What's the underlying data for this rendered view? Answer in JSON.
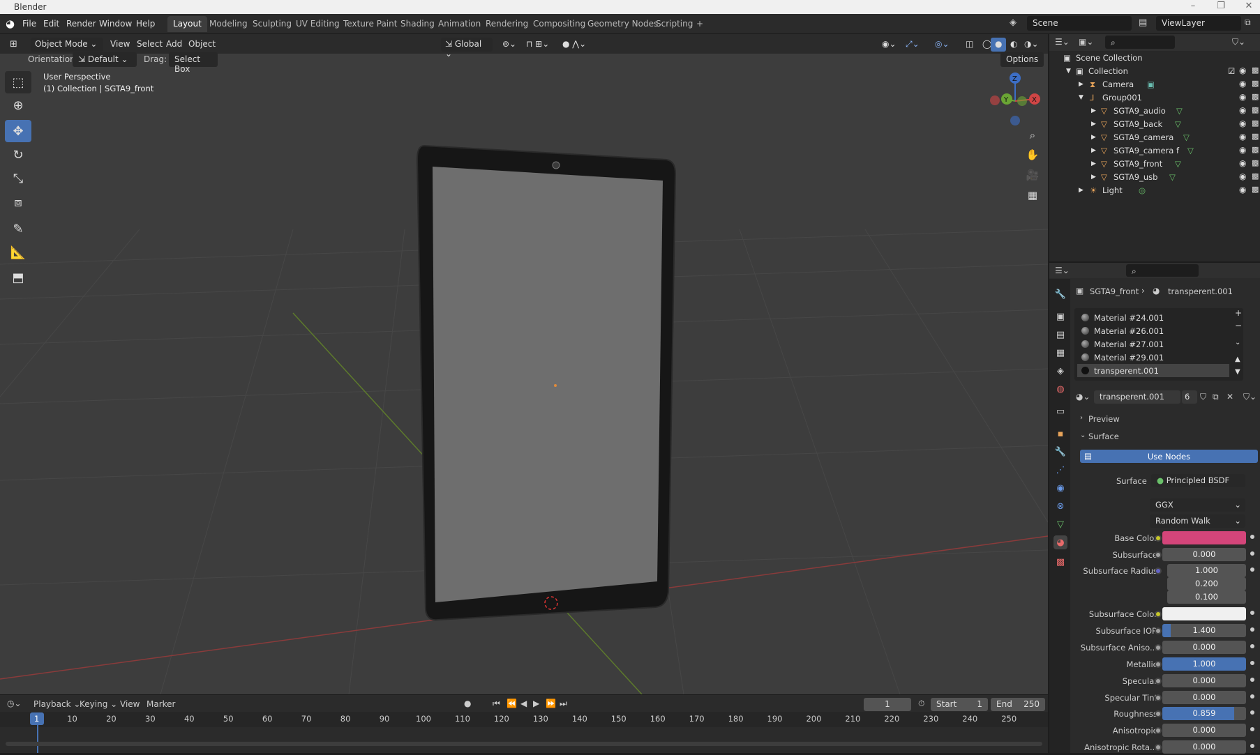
{
  "title_bar": {
    "title": "Blender",
    "minimize": "–",
    "restore": "❐",
    "close": "✕"
  },
  "menu": [
    "File",
    "Edit",
    "Render",
    "Window",
    "Help"
  ],
  "workspaces": [
    "Layout",
    "Modeling",
    "Sculpting",
    "UV Editing",
    "Texture Paint",
    "Shading",
    "Animation",
    "Rendering",
    "Compositing",
    "Geometry Nodes",
    "Scripting",
    "+"
  ],
  "scene": {
    "name": "Scene",
    "view_layer": "ViewLayer"
  },
  "viewport_header": {
    "mode": "Object Mode",
    "view": "View",
    "select": "Select",
    "add": "Add",
    "object": "Object",
    "transform": "Global",
    "orientation_label": "Orientation:",
    "orientation": "Default",
    "drag_label": "Drag:",
    "drag": "Select Box",
    "options": "Options"
  },
  "viewport_info": {
    "line1": "User Perspective",
    "line2": "(1) Collection | SGTA9_front"
  },
  "gizmo": {
    "x": "X",
    "y": "Y",
    "z": "Z"
  },
  "outliner": {
    "scene_collection": "Scene Collection",
    "collection": "Collection",
    "items": [
      {
        "label": "Camera"
      },
      {
        "label": "Group001"
      },
      {
        "label": "SGTA9_audio"
      },
      {
        "label": "SGTA9_back"
      },
      {
        "label": "SGTA9_camera"
      },
      {
        "label": "SGTA9_camera f"
      },
      {
        "label": "SGTA9_front"
      },
      {
        "label": "SGTA9_usb"
      },
      {
        "label": "Light"
      }
    ]
  },
  "properties": {
    "breadcrumb_object": "SGTA9_front",
    "breadcrumb_material": "transperent.001",
    "materials": [
      "Material #24.001",
      "Material #26.001",
      "Material #27.001",
      "Material #29.001",
      "transperent.001"
    ],
    "material_name": "transperent.001",
    "users": "6",
    "preview": "Preview",
    "surface_panel": "Surface",
    "use_nodes": "Use Nodes",
    "surface_label": "Surface",
    "surface_shader": "Principled BSDF",
    "distribution": "GGX",
    "subsurface_method": "Random Walk",
    "rows": [
      {
        "label": "Base Color",
        "value": ""
      },
      {
        "label": "Subsurface",
        "value": "0.000"
      },
      {
        "label": "Subsurface Radius",
        "value": "1.000"
      },
      {
        "label": "",
        "value": "0.200"
      },
      {
        "label": "",
        "value": "0.100"
      },
      {
        "label": "Subsurface Color",
        "value": ""
      },
      {
        "label": "Subsurface IOR",
        "value": "1.400"
      },
      {
        "label": "Subsurface Aniso...",
        "value": "0.000"
      },
      {
        "label": "Metallic",
        "value": "1.000"
      },
      {
        "label": "Specular",
        "value": "0.000"
      },
      {
        "label": "Specular Tint",
        "value": "0.000"
      },
      {
        "label": "Roughness",
        "value": "0.859"
      },
      {
        "label": "Anisotropic",
        "value": "0.000"
      },
      {
        "label": "Anisotropic Rota...",
        "value": "0.000"
      }
    ],
    "base_color": "#d4457a",
    "subsurface_color": "#f0f0f0"
  },
  "timeline": {
    "playback": "Playback",
    "keying": "Keying",
    "view": "View",
    "marker": "Marker",
    "current_frame": "1",
    "start_label": "Start",
    "start": "1",
    "end_label": "End",
    "end": "250",
    "ticks": [
      "1",
      "10",
      "20",
      "30",
      "40",
      "50",
      "60",
      "70",
      "80",
      "90",
      "100",
      "110",
      "120",
      "130",
      "140",
      "150",
      "160",
      "170",
      "180",
      "190",
      "200",
      "210",
      "220",
      "230",
      "240",
      "250"
    ]
  },
  "colors": {
    "accent": "#4772b3",
    "active_frame": "#4772b3"
  }
}
